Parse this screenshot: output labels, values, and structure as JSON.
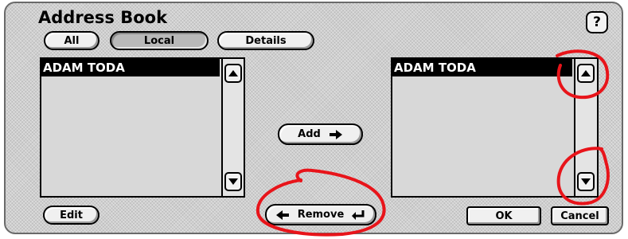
{
  "dialog": {
    "title": "Address Book",
    "help_label": "?"
  },
  "filter_tabs": [
    {
      "label": "All",
      "selected": false
    },
    {
      "label": "Local",
      "selected": true
    },
    {
      "label": "Details",
      "selected": false
    }
  ],
  "source_list": {
    "items": [
      "ADAM TODA"
    ],
    "selected_index": 0
  },
  "destination_list": {
    "items": [
      "ADAM TODA"
    ],
    "selected_index": 0
  },
  "buttons": {
    "add": "Add",
    "remove": "Remove",
    "edit": "Edit",
    "ok": "OK",
    "cancel": "Cancel"
  },
  "icons": {
    "scroll_up": "up-triangle",
    "scroll_down": "down-triangle",
    "add_arrow": "right-arrow",
    "remove_arrow": "left-arrow",
    "remove_return": "return-arrow"
  },
  "annotation_color": "#e8141a"
}
